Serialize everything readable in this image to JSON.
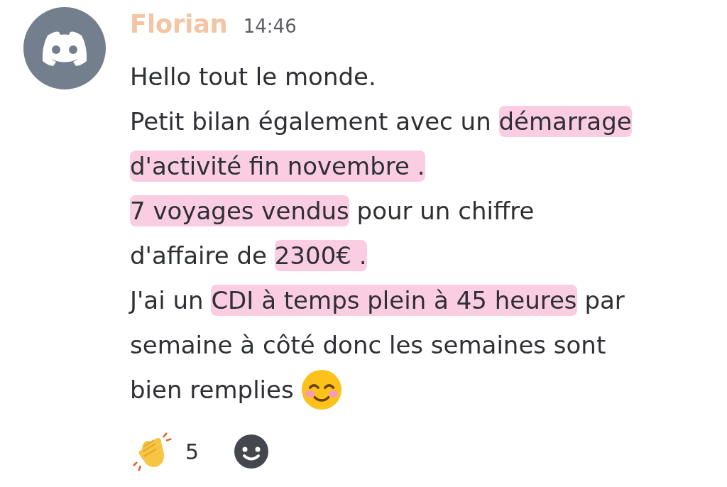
{
  "message": {
    "author": "Florian",
    "time": "14:46",
    "lines": [
      {
        "segments": [
          {
            "text": "Hello tout le monde.",
            "highlighted": false
          }
        ]
      },
      {
        "segments": [
          {
            "text": "Petit bilan également avec un ",
            "highlighted": false
          },
          {
            "text": "démarrage",
            "highlighted": true
          }
        ]
      },
      {
        "segments": [
          {
            "text": "d'activité fin novembre .",
            "highlighted": true
          }
        ]
      },
      {
        "segments": [
          {
            "text": "7 voyages vendus",
            "highlighted": true
          },
          {
            "text": " pour un chiffre",
            "highlighted": false
          }
        ]
      },
      {
        "segments": [
          {
            "text": "d'affaire de ",
            "highlighted": false
          },
          {
            "text": "2300€ .",
            "highlighted": true
          }
        ]
      },
      {
        "segments": [
          {
            "text": "J'ai un ",
            "highlighted": false
          },
          {
            "text": "CDI à temps plein à 45 heures",
            "highlighted": true
          },
          {
            "text": " par",
            "highlighted": false
          }
        ]
      },
      {
        "segments": [
          {
            "text": "semaine à côté donc les semaines sont",
            "highlighted": false
          }
        ]
      },
      {
        "segments": [
          {
            "text": "bien remplies",
            "highlighted": false
          }
        ],
        "trailing_emoji": true
      }
    ],
    "reactions": [
      {
        "count": "5"
      }
    ]
  }
}
